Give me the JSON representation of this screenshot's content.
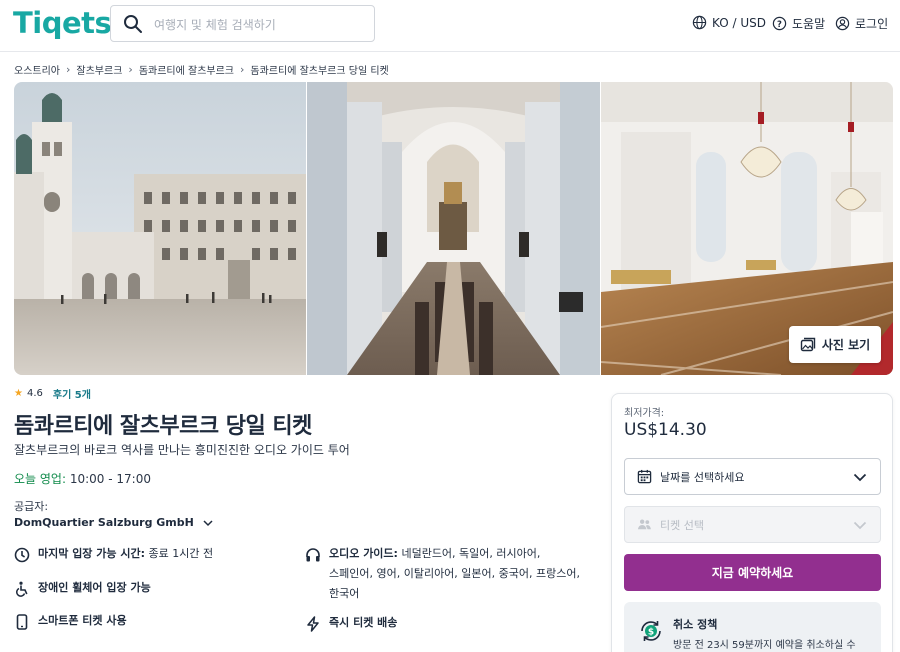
{
  "header": {
    "logo": "Tiqets",
    "search_placeholder": "여행지 및 체험 검색하기",
    "lang_currency": "KO / USD",
    "help": "도움말",
    "login": "로그인"
  },
  "breadcrumb": [
    "오스트리아",
    "잘츠부르크",
    "돔콰르티에 잘츠부르크",
    "돔콰르티에 잘츠부르크 당일 티켓"
  ],
  "gallery": {
    "photos_button": "사진 보기"
  },
  "product": {
    "rating": "4.6",
    "reviews": "후기 5개",
    "title": "돔콰르티에 잘츠부르크 당일 티켓",
    "subtitle": "잘츠부르크의 바로크 역사를 만나는 흥미진진한 오디오 가이드 투어",
    "open_label": "오늘 영업:",
    "open_hours": "10:00 - 17:00",
    "supplier_label": "공급자:",
    "supplier_name": "DomQuartier Salzburg GmbH"
  },
  "features": {
    "last_entry_label": "마지막 입장 가능 시간:",
    "last_entry_value": "종료 1시간 전",
    "wheelchair": "장애인 휠체어 입장 가능",
    "smartphone": "스마트폰 티켓 사용",
    "audio_label": "오디오 가이드:",
    "audio_langs_1": "네덜란드어, 독일어, 러시아어,",
    "audio_langs_2": "스페인어, 영어, 이탈리아어, 일본어, 중국어, 프랑스어,",
    "audio_langs_3": "한국어",
    "instant": "즉시 티켓 배송"
  },
  "booking": {
    "price_label": "최저가격:",
    "price": "US$14.30",
    "date_select": "날짜를 선택하세요",
    "ticket_select": "티켓 선택",
    "book_button": "지금 예약하세요",
    "cancel_title": "취소 정책",
    "cancel_text": "방문 전 23시 59분까지 예약을 취소하실 수"
  },
  "colors": {
    "brand": "#18a8a3",
    "book_button": "#922f8f",
    "open_green": "#0f8a4a",
    "star": "#f5a623"
  }
}
